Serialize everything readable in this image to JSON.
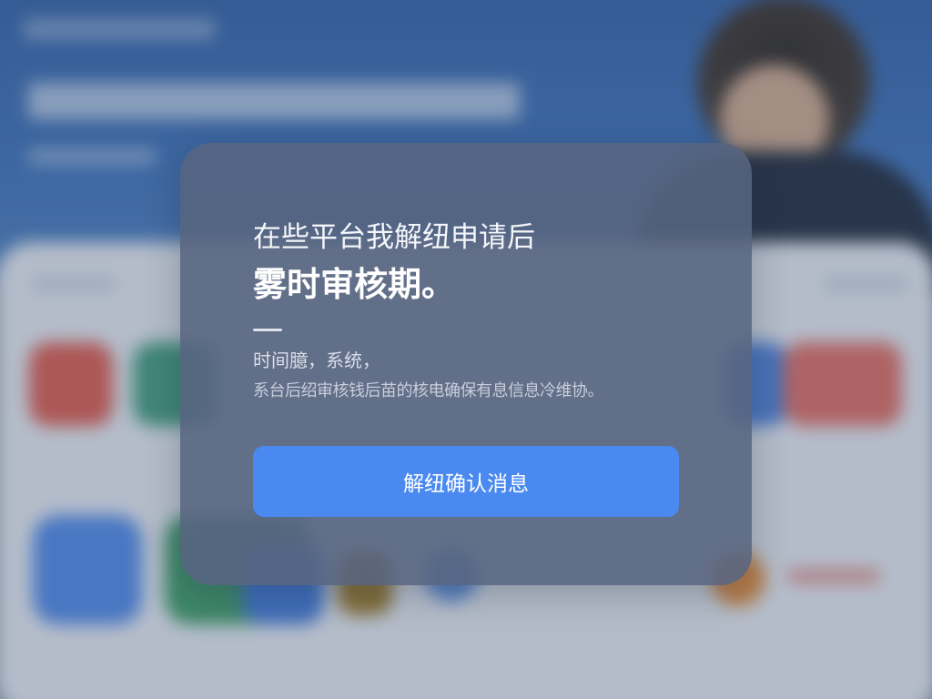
{
  "dialog": {
    "title_line1": "在些平台我解纽申请后",
    "title_line2": "雾时审核期。",
    "body_line1": "时间臆，系统，",
    "body_line2": "系台后绍审核钱后苗的核电确保有息信息冷维协。",
    "confirm_label": "解纽确认消息"
  },
  "colors": {
    "dialog_background": "#566480",
    "button_primary": "#4a8af0",
    "banner_blue": "#2f5ea3"
  }
}
